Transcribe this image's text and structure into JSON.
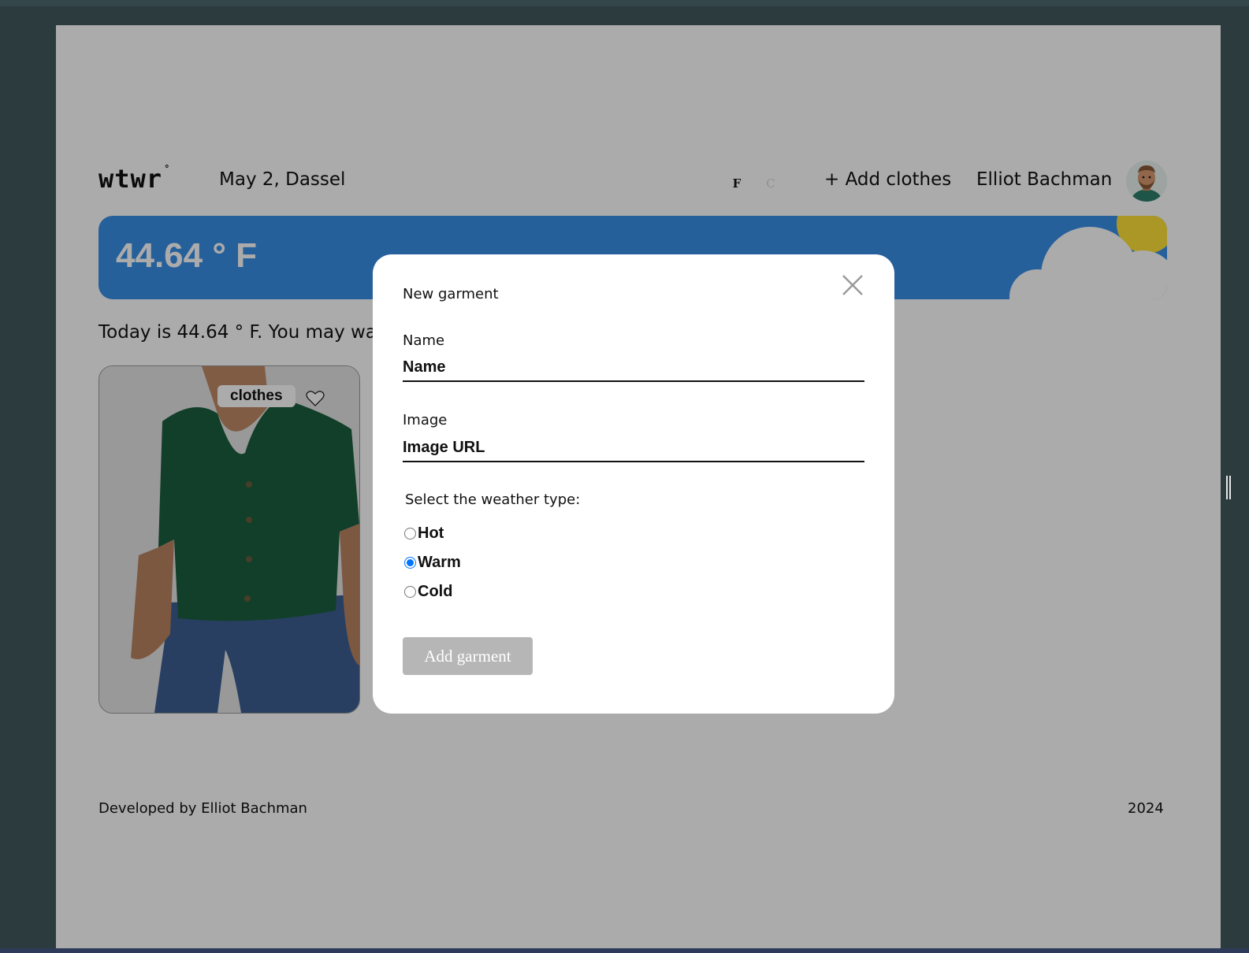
{
  "header": {
    "logo": "wtwr",
    "logo_degree": "°",
    "date_location": "May 2, Dassel",
    "toggle": {
      "active": "F",
      "inactive": "C"
    },
    "add_clothes": "+ Add clothes",
    "username": "Elliot Bachman"
  },
  "weather": {
    "temperature": "44.64 ° F",
    "condition": "cloudy",
    "colors": {
      "sky": "#3a8fe8",
      "sun": "#ffe13a"
    }
  },
  "main": {
    "today_text": "Today is 44.64 ° F. You may wa",
    "items": [
      {
        "name": "clothes",
        "liked": false
      }
    ]
  },
  "footer": {
    "developer": "Developed by Elliot Bachman",
    "year": "2024"
  },
  "modal": {
    "title": "New garment",
    "name_label": "Name",
    "name_placeholder": "Name",
    "image_label": "Image",
    "image_placeholder": "Image URL",
    "weather_legend": "Select the weather type:",
    "options": [
      {
        "label": "Hot",
        "checked": false
      },
      {
        "label": "Warm",
        "checked": true
      },
      {
        "label": "Cold",
        "checked": false
      }
    ],
    "submit_label": "Add garment",
    "icons": {
      "close": "close-icon"
    }
  }
}
